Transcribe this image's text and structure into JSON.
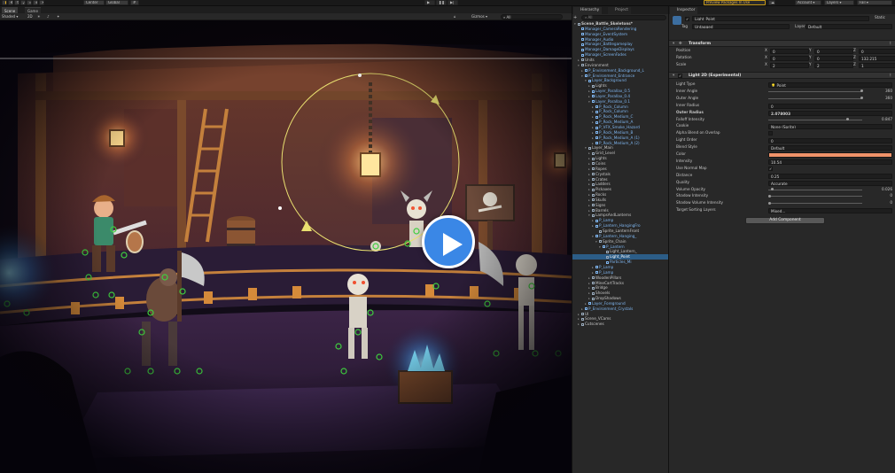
{
  "toolbar": {
    "center_label": "Center",
    "global_label": "Global",
    "preview_label": "Preview Packages In Use",
    "account_label": "Account",
    "layers_label": "Layers",
    "layout_label": "Fail"
  },
  "scene_view": {
    "tabs": [
      "Scene",
      "Game"
    ],
    "shading_mode": "Shaded",
    "mode_2d": "2D",
    "gizmos_label": "Gizmos",
    "search_placeholder": "All"
  },
  "video_overlay": {
    "icon": "play-icon"
  },
  "hierarchy": {
    "tabs": [
      "Hierarchy",
      "Project"
    ],
    "search_placeholder": "All",
    "rows": [
      {
        "label": "Scene_Battle_Skeletons*",
        "depth": 0,
        "arrow": "▾",
        "kind": "scene"
      },
      {
        "label": "Manager_CameraRendering",
        "depth": 1,
        "arrow": "",
        "kind": "blue"
      },
      {
        "label": "Manager_EventSystem",
        "depth": 1,
        "arrow": "",
        "kind": "blue"
      },
      {
        "label": "Manager_Audio",
        "depth": 1,
        "arrow": "",
        "kind": "blue"
      },
      {
        "label": "Manager_Battlegameplay",
        "depth": 1,
        "arrow": "",
        "kind": "blue"
      },
      {
        "label": "Manager_DamageDisplays",
        "depth": 1,
        "arrow": "",
        "kind": "blue"
      },
      {
        "label": "Manager_ScreenFades",
        "depth": 1,
        "arrow": "",
        "kind": "blue"
      },
      {
        "label": "Units",
        "depth": 1,
        "arrow": "▸",
        "kind": "normal"
      },
      {
        "label": "Environment",
        "depth": 1,
        "arrow": "▾",
        "kind": "normal"
      },
      {
        "label": "P_Environment_Background_L",
        "depth": 2,
        "arrow": "▸",
        "kind": "blue"
      },
      {
        "label": "P_Environment_Entrance",
        "depth": 2,
        "arrow": "▾",
        "kind": "blue"
      },
      {
        "label": "Layer_Background",
        "depth": 3,
        "arrow": "▾",
        "kind": "blue"
      },
      {
        "label": "Lights",
        "depth": 4,
        "arrow": "▸",
        "kind": "normal"
      },
      {
        "label": "Layer_Parallax_0.5",
        "depth": 4,
        "arrow": "▸",
        "kind": "blue"
      },
      {
        "label": "Layer_Parallax_0.4",
        "depth": 4,
        "arrow": "▸",
        "kind": "blue"
      },
      {
        "label": "Layer_Parallax_0.1",
        "depth": 4,
        "arrow": "▾",
        "kind": "blue"
      },
      {
        "label": "P_Rock_Column",
        "depth": 5,
        "arrow": "▸",
        "kind": "blue"
      },
      {
        "label": "P_Rock_Column",
        "depth": 5,
        "arrow": "▸",
        "kind": "blue"
      },
      {
        "label": "P_Rock_Medium_C",
        "depth": 5,
        "arrow": "▸",
        "kind": "blue"
      },
      {
        "label": "P_Rock_Medium_A",
        "depth": 5,
        "arrow": "▸",
        "kind": "blue"
      },
      {
        "label": "P_VFX_Smoke_Hazard",
        "depth": 5,
        "arrow": "▸",
        "kind": "blue"
      },
      {
        "label": "P_Rock_Medium_B",
        "depth": 5,
        "arrow": "▸",
        "kind": "blue"
      },
      {
        "label": "P_Rock_Medium_A (1)",
        "depth": 5,
        "arrow": "▸",
        "kind": "blue"
      },
      {
        "label": "P_Rock_Medium_A (2)",
        "depth": 5,
        "arrow": "▸",
        "kind": "blue"
      },
      {
        "label": "Layer_Main",
        "depth": 3,
        "arrow": "▾",
        "kind": "normal"
      },
      {
        "label": "Grid_Level",
        "depth": 4,
        "arrow": "▸",
        "kind": "normal"
      },
      {
        "label": "Lights",
        "depth": 4,
        "arrow": "▸",
        "kind": "normal"
      },
      {
        "label": "Coins",
        "depth": 4,
        "arrow": "▸",
        "kind": "normal"
      },
      {
        "label": "Ropes",
        "depth": 4,
        "arrow": "▸",
        "kind": "normal"
      },
      {
        "label": "Crystals",
        "depth": 4,
        "arrow": "▸",
        "kind": "normal"
      },
      {
        "label": "Crates",
        "depth": 4,
        "arrow": "▸",
        "kind": "normal"
      },
      {
        "label": "Ladders",
        "depth": 4,
        "arrow": "▸",
        "kind": "normal"
      },
      {
        "label": "Pickaxes",
        "depth": 4,
        "arrow": "▸",
        "kind": "normal"
      },
      {
        "label": "Rocks",
        "depth": 4,
        "arrow": "▸",
        "kind": "normal"
      },
      {
        "label": "Skulls",
        "depth": 4,
        "arrow": "▸",
        "kind": "normal"
      },
      {
        "label": "Signs",
        "depth": 4,
        "arrow": "▸",
        "kind": "normal"
      },
      {
        "label": "Barrels",
        "depth": 4,
        "arrow": "▸",
        "kind": "normal"
      },
      {
        "label": "LampsAndLanterns",
        "depth": 4,
        "arrow": "▾",
        "kind": "normal"
      },
      {
        "label": "P_Lamp",
        "depth": 5,
        "arrow": "▸",
        "kind": "blue"
      },
      {
        "label": "P_Lantern_HangingFro",
        "depth": 5,
        "arrow": "▸",
        "kind": "blue"
      },
      {
        "label": "Sprite_LanternFront",
        "depth": 6,
        "arrow": "",
        "kind": "normal"
      },
      {
        "label": "P_Lantern_Hanging_",
        "depth": 5,
        "arrow": "▾",
        "kind": "blue"
      },
      {
        "label": "Sprite_Chain",
        "depth": 6,
        "arrow": "▾",
        "kind": "normal"
      },
      {
        "label": "P_Lantern",
        "depth": 7,
        "arrow": "▾",
        "kind": "blue"
      },
      {
        "label": "Light_Lantern_",
        "depth": 8,
        "arrow": "",
        "kind": "normal"
      },
      {
        "label": "Light_Point",
        "depth": 8,
        "arrow": "",
        "kind": "selected"
      },
      {
        "label": "Particles_Mi",
        "depth": 8,
        "arrow": "",
        "kind": "blue"
      },
      {
        "label": "P_Lamp",
        "depth": 5,
        "arrow": "▸",
        "kind": "blue"
      },
      {
        "label": "P_Lamp",
        "depth": 5,
        "arrow": "▸",
        "kind": "blue"
      },
      {
        "label": "WoodenPillars",
        "depth": 4,
        "arrow": "▸",
        "kind": "normal"
      },
      {
        "label": "MineCartTracks",
        "depth": 4,
        "arrow": "▸",
        "kind": "normal"
      },
      {
        "label": "Bridge",
        "depth": 4,
        "arrow": "▸",
        "kind": "normal"
      },
      {
        "label": "Shovels",
        "depth": 4,
        "arrow": "▸",
        "kind": "normal"
      },
      {
        "label": "DropShadows",
        "depth": 4,
        "arrow": "▸",
        "kind": "normal"
      },
      {
        "label": "Layer_Foreground",
        "depth": 3,
        "arrow": "▸",
        "kind": "blue"
      },
      {
        "label": "P_Environment_Crystals",
        "depth": 2,
        "arrow": "▸",
        "kind": "blue"
      },
      {
        "label": "UI",
        "depth": 1,
        "arrow": "▸",
        "kind": "normal"
      },
      {
        "label": "Scene_VCams",
        "depth": 1,
        "arrow": "▸",
        "kind": "normal"
      },
      {
        "label": "Cutscenes",
        "depth": 1,
        "arrow": "▸",
        "kind": "normal"
      }
    ]
  },
  "inspector": {
    "tab": "Inspector",
    "object_name": "Light_Point",
    "static_label": "Static",
    "tag_label": "Tag",
    "tag_value": "Untagged",
    "layer_label": "Layer",
    "layer_value": "Default",
    "transform": {
      "title": "Transform",
      "position_label": "Position",
      "rotation_label": "Rotation",
      "scale_label": "Scale",
      "position": [
        "0",
        "0",
        "0"
      ],
      "rotation": [
        "0",
        "0",
        "132.215"
      ],
      "scale": [
        "2",
        "2",
        "1"
      ],
      "axis_labels": [
        "X",
        "Y",
        "Z"
      ]
    },
    "light2d": {
      "title": "Light 2D (Experimental)",
      "fields": [
        {
          "label": "Light Type",
          "value": "Point",
          "kind": "dropdown"
        },
        {
          "label": "Inner Angle",
          "value": "360",
          "kind": "slider",
          "level": 1.0
        },
        {
          "label": "Outer Angle",
          "value": "360",
          "kind": "slider",
          "level": 1.0
        },
        {
          "label": "Inner Radius",
          "value": "0",
          "kind": "text"
        },
        {
          "label": "Outer Radius",
          "value": "2.078003",
          "kind": "text",
          "bold": true
        },
        {
          "label": "Falloff Intensity",
          "value": "0.847",
          "kind": "slider",
          "level": 0.847
        },
        {
          "label": "Cookie",
          "value": "None (Sprite)",
          "kind": "object"
        },
        {
          "label": "Alpha Blend on Overlap",
          "value": "",
          "kind": "checkbox",
          "checked": false
        },
        {
          "label": "Light Order",
          "value": "0",
          "kind": "text"
        },
        {
          "label": "Blend Style",
          "value": "Default",
          "kind": "dropdown"
        },
        {
          "label": "Color",
          "value": "#f0936a",
          "kind": "color"
        },
        {
          "label": "Intensity",
          "value": "10.54",
          "kind": "text"
        },
        {
          "label": "Use Normal Map",
          "value": "",
          "kind": "checkbox",
          "checked": true
        },
        {
          "label": "Distance",
          "value": "0.25",
          "kind": "text"
        },
        {
          "label": "Quality",
          "value": "Accurate",
          "kind": "dropdown"
        },
        {
          "label": "Volume Opacity",
          "value": "0.026",
          "kind": "slider",
          "level": 0.026
        },
        {
          "label": "Shadow Intensity",
          "value": "0",
          "kind": "slider",
          "level": 0.0
        },
        {
          "label": "Shadow Volume Intensity",
          "value": "0",
          "kind": "slider",
          "level": 0.0
        },
        {
          "label": "Target Sorting Layers",
          "value": "Mixed...",
          "kind": "dropdown"
        }
      ]
    },
    "add_component_label": "Add Component"
  },
  "colors": {
    "selection": "#2c5d87",
    "prefab_blue": "#7fb6f0",
    "light_color": "#f0936a",
    "play_button": "#3a87e6"
  }
}
